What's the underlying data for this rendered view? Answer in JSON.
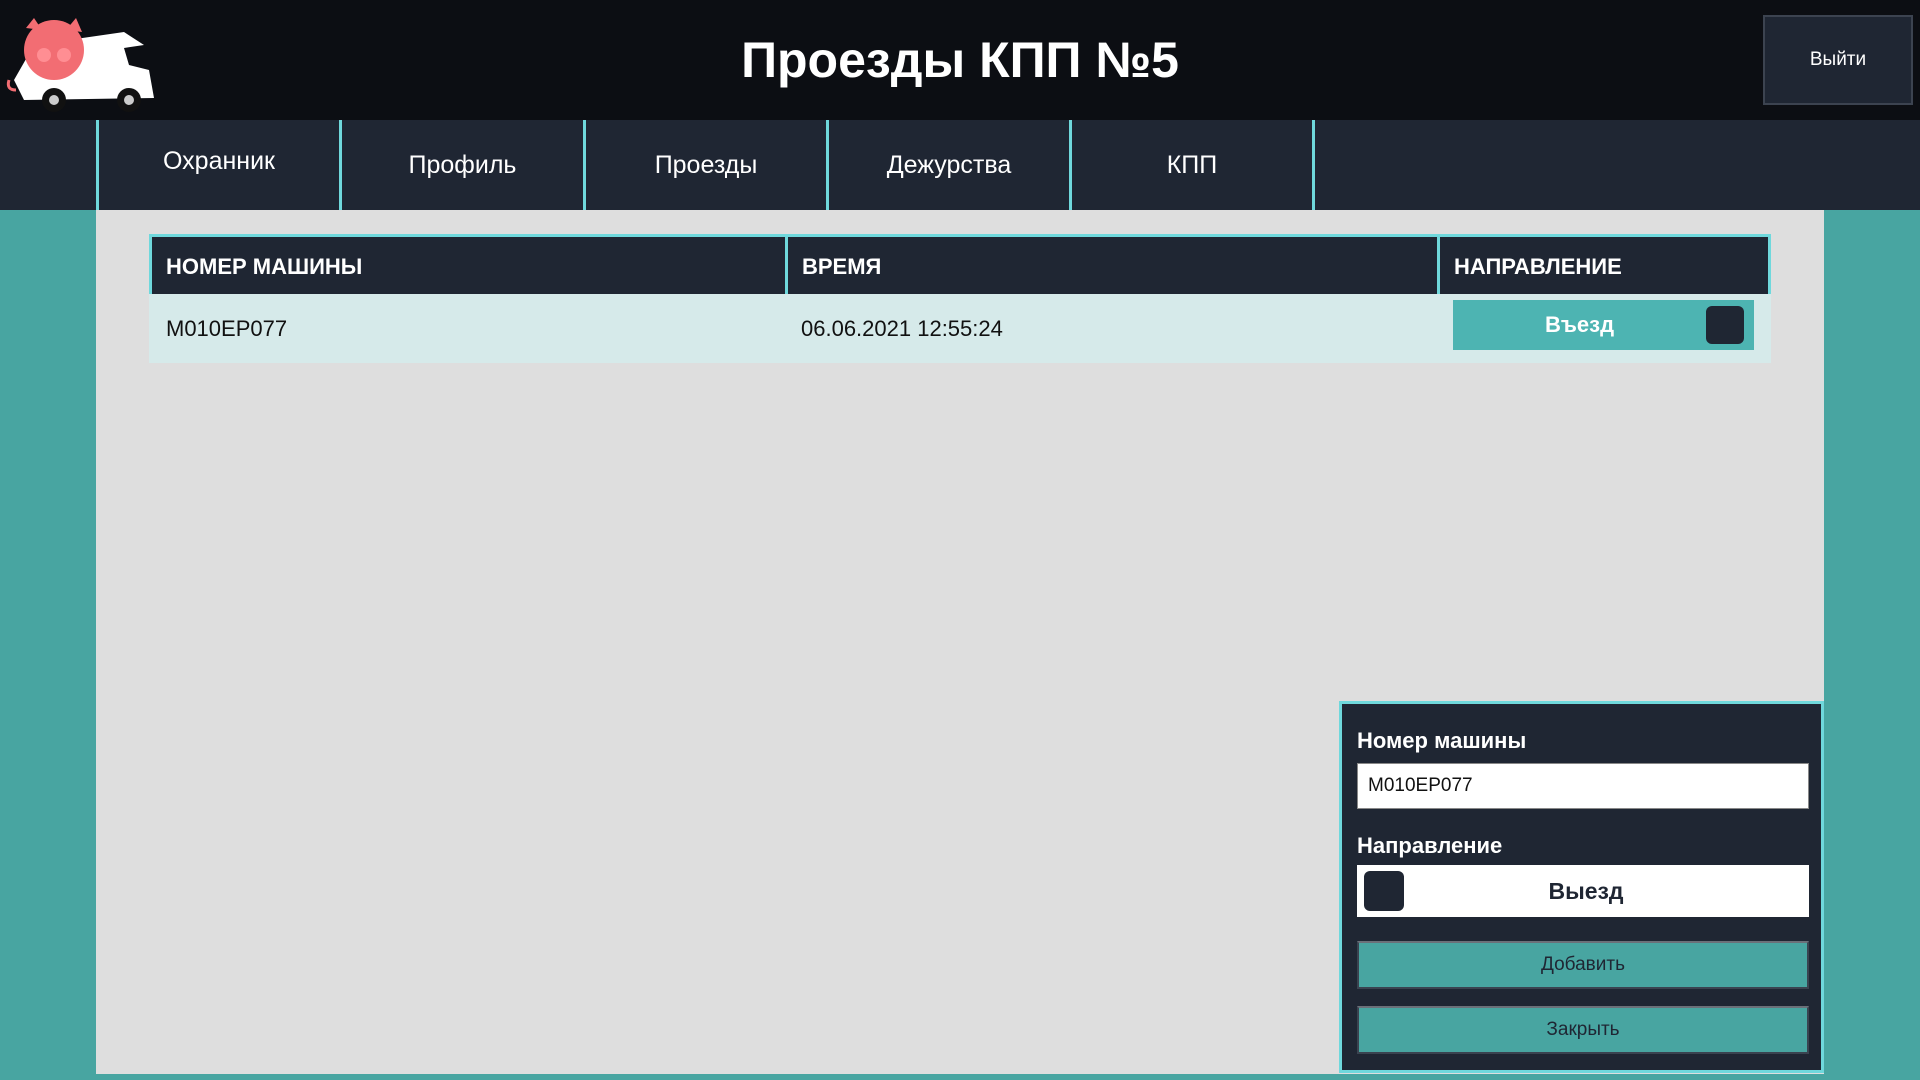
{
  "header": {
    "title": "Проезды КПП №5",
    "logout_label": "Выйти"
  },
  "nav": {
    "items": [
      {
        "label": "Охранник"
      },
      {
        "label": "Профиль"
      },
      {
        "label": "Проезды"
      },
      {
        "label": "Дежурства"
      },
      {
        "label": "КПП"
      }
    ]
  },
  "table": {
    "columns": [
      "НОМЕР МАШИНЫ",
      "ВРЕМЯ",
      "НАПРАВЛЕНИЕ"
    ],
    "rows": [
      {
        "plate": "M010EP077",
        "time": "06.06.2021 12:55:24",
        "direction": "Въезд"
      }
    ]
  },
  "form": {
    "plate_label": "Номер машины",
    "plate_value": "M010EP077",
    "direction_label": "Направление",
    "direction_value": "Выезд",
    "add_label": "Добавить",
    "close_label": "Закрыть"
  },
  "colors": {
    "accent": "#48a5a1",
    "dark": "#1f2633",
    "border": "#6fd8dc",
    "logo_pig": "#f26d73"
  },
  "icons": {
    "logo": "pig-truck-logo"
  }
}
